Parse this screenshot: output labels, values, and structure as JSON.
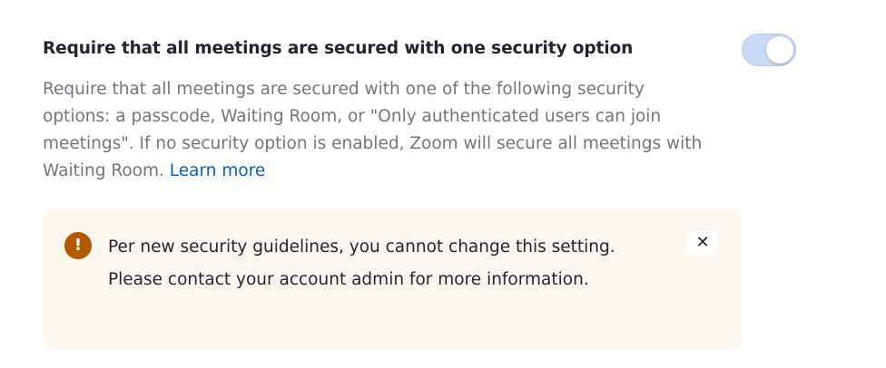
{
  "setting": {
    "title": "Require that all meetings are secured with one security option",
    "toggle_state": "on",
    "description": "Require that all meetings are secured with one of the following security options: a passcode, Waiting Room, or \"Only authenticated users can join meetings\". If no security option is enabled, Zoom will secure all meetings with Waiting Room. ",
    "learn_more_label": "Learn more"
  },
  "alert": {
    "icon": "exclamation-icon",
    "icon_glyph": "!",
    "message": "Per new security guidelines, you cannot change this setting. Please contact your account admin for more information.",
    "close_glyph": "✕"
  },
  "colors": {
    "accent": "#0e5bbf",
    "toggle_on": "#c9daf8",
    "alert_bg": "#fff6ee",
    "warning_icon": "#b35a00"
  }
}
